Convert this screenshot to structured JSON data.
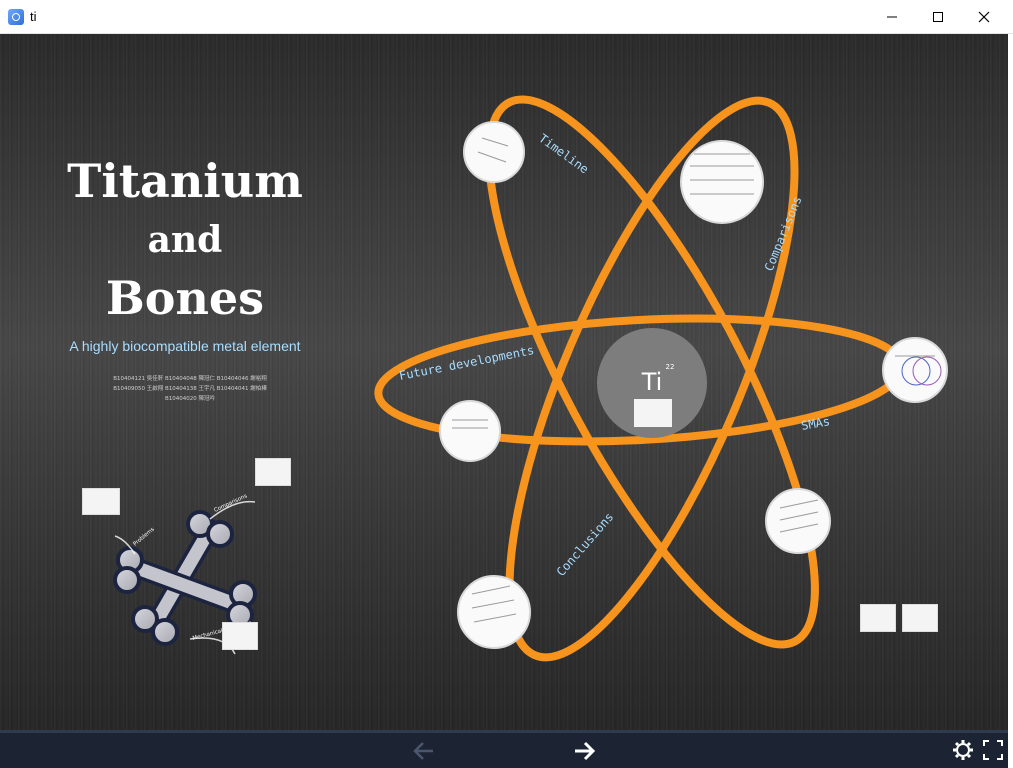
{
  "window": {
    "title": "ti",
    "app_icon": "prezi-icon"
  },
  "presentation": {
    "title_line1": "Titanium",
    "title_line2": "and",
    "title_line3": "Bones",
    "subtitle": "A highly biocompatible metal element",
    "authors": [
      "B10404121 吳佳軒  B10404048 陳冠仁  B10404046 謝裕翔",
      "B10409050 王啟翔  B10404138 王宇凡  B10404041 謝柏樺",
      "B10404020 陳冠吟"
    ]
  },
  "atom": {
    "nucleus_symbol": "Ti",
    "nucleus_number": "22",
    "labels": {
      "timeline": "Timeline",
      "comparisons": "Comparisons",
      "future": "Future developments",
      "smas": "SMAs",
      "conclusions": "Conclusions"
    },
    "orbit_color": "#f7941d"
  },
  "bone_diagram": {
    "labels": [
      "Comparisons",
      "Problems",
      "Mechanical properties"
    ]
  },
  "controls": {
    "prev_icon": "arrow-left-icon",
    "next_icon": "arrow-right-icon",
    "settings_icon": "gear-icon",
    "fullscreen_icon": "fullscreen-icon"
  }
}
